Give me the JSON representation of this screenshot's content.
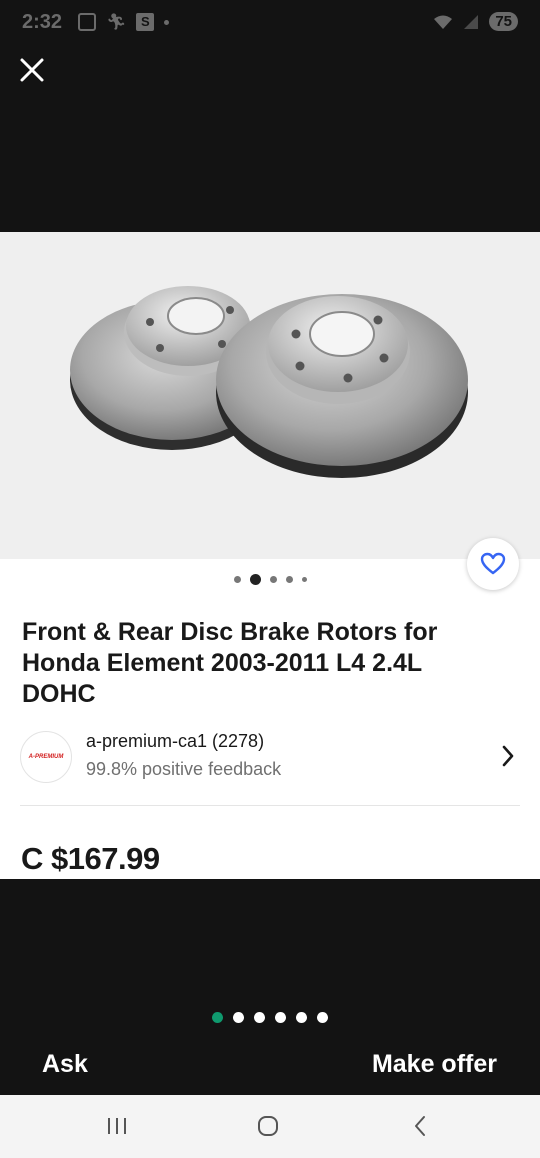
{
  "status_bar": {
    "time": "2:32",
    "battery": "75"
  },
  "product": {
    "title": "Front & Rear Disc Brake Rotors for Honda Element 2003-2011 L4 2.4L DOHC",
    "price": "C $167.99",
    "image_count": 5,
    "active_image": 1
  },
  "seller": {
    "logo_text": "A-PREMIUM",
    "name": "a-premium-ca1 (2278)",
    "feedback": "99.8% positive feedback"
  },
  "pager": {
    "count": 6,
    "active": 0
  },
  "actions": {
    "ask_label": "Ask",
    "make_offer_label": "Make offer"
  },
  "colors": {
    "accent": "#0f9a6e",
    "favorite": "#3665f3",
    "background": "#131313"
  },
  "icons": {
    "close": "close-icon",
    "favorite": "heart-icon",
    "seller_chevron": "chevron-right-icon",
    "nav_recents": "recents-icon",
    "nav_home": "home-icon",
    "nav_back": "back-icon"
  }
}
